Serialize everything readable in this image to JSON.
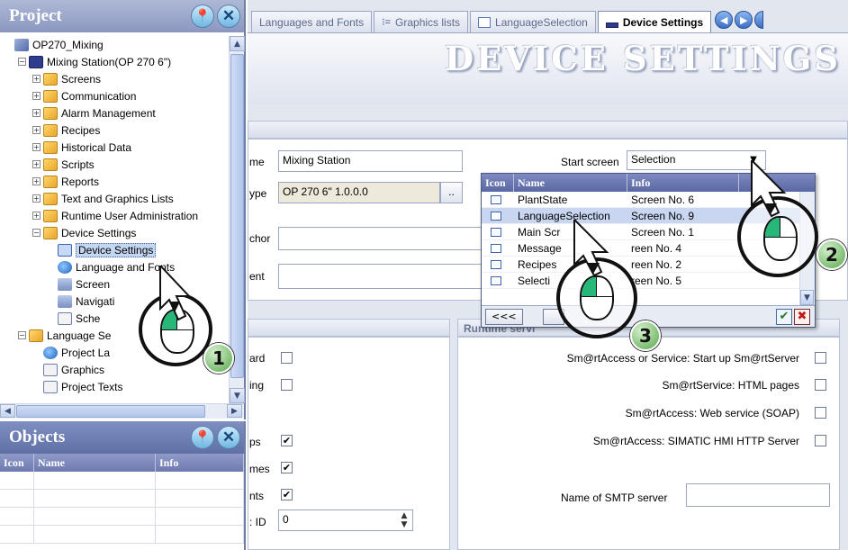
{
  "project_panel": {
    "title": "Project",
    "tree": [
      {
        "label": "OP270_Mixing",
        "indent": 0,
        "icon": "project-icon",
        "expander": ""
      },
      {
        "label": "Mixing Station(OP 270 6\")",
        "indent": 1,
        "icon": "device-icon",
        "expander": "−"
      },
      {
        "label": "Screens",
        "indent": 2,
        "icon": "folder-icon",
        "expander": "+"
      },
      {
        "label": "Communication",
        "indent": 2,
        "icon": "folder-icon",
        "expander": "+"
      },
      {
        "label": "Alarm Management",
        "indent": 2,
        "icon": "folder-icon",
        "expander": "+"
      },
      {
        "label": "Recipes",
        "indent": 2,
        "icon": "folder-icon",
        "expander": "+"
      },
      {
        "label": "Historical Data",
        "indent": 2,
        "icon": "folder-icon",
        "expander": "+"
      },
      {
        "label": "Scripts",
        "indent": 2,
        "icon": "folder-icon",
        "expander": "+"
      },
      {
        "label": "Reports",
        "indent": 2,
        "icon": "folder-icon",
        "expander": "+"
      },
      {
        "label": "Text and Graphics Lists",
        "indent": 2,
        "icon": "folder-icon",
        "expander": "+"
      },
      {
        "label": "Runtime User Administration",
        "indent": 2,
        "icon": "folder-icon",
        "expander": "+"
      },
      {
        "label": "Device Settings",
        "indent": 2,
        "icon": "folder-icon",
        "expander": "−"
      },
      {
        "label": "Device Settings",
        "indent": 3,
        "icon": "screen-icon",
        "expander": "",
        "selected": true
      },
      {
        "label": "Language and Fonts",
        "indent": 3,
        "icon": "globe-icon",
        "expander": ""
      },
      {
        "label": "Screen",
        "indent": 3,
        "icon": "network-icon",
        "expander": ""
      },
      {
        "label": "Navigati",
        "indent": 3,
        "icon": "network-icon",
        "expander": ""
      },
      {
        "label": "Sche",
        "indent": 3,
        "icon": "doc-icon",
        "expander": ""
      },
      {
        "label": "Language Se",
        "indent": 1,
        "icon": "folder-icon",
        "expander": "−"
      },
      {
        "label": "Project La",
        "indent": 2,
        "icon": "globe-icon",
        "expander": ""
      },
      {
        "label": "Graphics",
        "indent": 2,
        "icon": "doc-icon",
        "expander": ""
      },
      {
        "label": "Project Texts",
        "indent": 2,
        "icon": "doc-icon",
        "expander": ""
      }
    ]
  },
  "objects_panel": {
    "title": "Objects",
    "columns": [
      "Icon",
      "Name",
      "Info"
    ]
  },
  "tabs": [
    {
      "label": "Languages and Fonts",
      "icon": "",
      "active": false
    },
    {
      "label": "Graphics lists",
      "icon": "list-icon",
      "active": false
    },
    {
      "label": "LanguageSelection",
      "icon": "screen-icon",
      "active": false
    },
    {
      "label": "Device Settings",
      "icon": "device-icon",
      "active": true
    }
  ],
  "header": {
    "title": "DEVICE SETTINGS"
  },
  "form": {
    "name_label": "me",
    "name_value": "Mixing Station",
    "type_label": "ype",
    "type_value": "OP 270 6\" 1.0.0.0",
    "type_browse": "..",
    "author_label": "chor",
    "comment_label": "ent",
    "start_screen_label": "Start screen",
    "start_screen_value": "Selection",
    "checks": [
      {
        "label": "ard",
        "checked": false
      },
      {
        "label": "ing",
        "checked": false
      },
      {
        "label": "ps",
        "checked": true
      },
      {
        "label": "mes",
        "checked": true
      },
      {
        "label": "nts",
        "checked": true
      }
    ],
    "id_label": ": ID",
    "id_value": "0",
    "runtime_section": "Runtime servi",
    "runtime_checks": [
      "Sm@rtAccess or Service: Start up Sm@rtServer",
      "Sm@rtService: HTML pages",
      "Sm@rtAccess: Web service (SOAP)",
      "Sm@rtAccess: SIMATIC HMI HTTP Server"
    ],
    "smtp_label": "Name of SMTP server",
    "smtp_value": ""
  },
  "dropdown": {
    "columns": [
      "Icon",
      "Name",
      "Info"
    ],
    "rows": [
      {
        "name": "PlantState",
        "info": "Screen No. 6",
        "selected": false
      },
      {
        "name": "LanguageSelection",
        "info": "Screen No. 9",
        "selected": true
      },
      {
        "name": "Main Scr",
        "info": "Screen No. 1",
        "selected": false
      },
      {
        "name": "Message",
        "info": "reen No. 4",
        "selected": false
      },
      {
        "name": "Recipes",
        "info": "reen No. 2",
        "selected": false
      },
      {
        "name": "Selecti",
        "info": "reen No. 5",
        "selected": false
      }
    ],
    "back_button": "<<<"
  },
  "callouts": [
    "1",
    "2",
    "3"
  ]
}
